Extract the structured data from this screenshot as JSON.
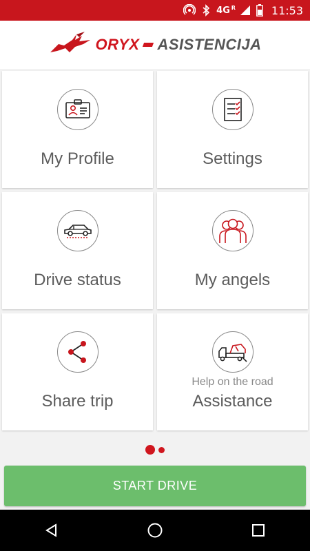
{
  "status_bar": {
    "network": "4G",
    "network_sub": "R",
    "time": "11:53",
    "icons": [
      "hotspot-icon",
      "bluetooth-icon",
      "signal-icon",
      "battery-icon"
    ]
  },
  "header": {
    "logo_part1": "ORYX",
    "logo_part2": "ASISTENCIJA"
  },
  "tiles": [
    {
      "label": "My Profile",
      "icon": "id-card-icon"
    },
    {
      "label": "Settings",
      "icon": "checklist-icon"
    },
    {
      "label": "Drive status",
      "icon": "car-icon"
    },
    {
      "label": "My angels",
      "icon": "group-icon"
    },
    {
      "label": "Share trip",
      "icon": "share-icon"
    },
    {
      "label": "Assistance",
      "subtitle": "Help on the road",
      "icon": "tow-truck-icon"
    }
  ],
  "pager": {
    "pages": 2,
    "current": 1
  },
  "start_button": {
    "label": "START DRIVE"
  },
  "nav_bar": {
    "icons": [
      "back-icon",
      "home-icon",
      "recents-icon"
    ]
  },
  "colors": {
    "brand_red": "#c8161d",
    "button_green": "#6cbe6c",
    "tile_text": "#5c5c5c"
  }
}
